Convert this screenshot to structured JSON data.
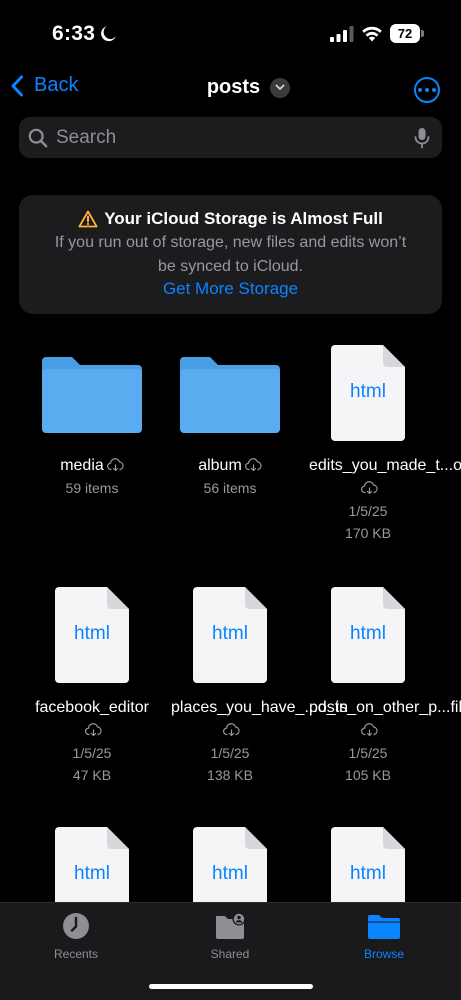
{
  "status": {
    "time": "6:33",
    "battery": "72"
  },
  "nav": {
    "back_label": "Back",
    "title": "posts"
  },
  "search": {
    "placeholder": "Search"
  },
  "banner": {
    "title": "Your iCloud Storage is Almost Full",
    "message": "If you run out of storage, new files and edits won’t be synced to iCloud.",
    "link": "Get More Storage"
  },
  "items": [
    {
      "kind": "folder",
      "name": "media",
      "meta1": "59 items",
      "meta2": ""
    },
    {
      "kind": "folder",
      "name": "album",
      "meta1": "56 items",
      "meta2": ""
    },
    {
      "kind": "file",
      "name": "edits_you_made_t...osts",
      "meta1": "1/5/25",
      "meta2": "170 KB"
    },
    {
      "kind": "file",
      "name": "facebook_editor",
      "meta1": "1/5/25",
      "meta2": "47 KB"
    },
    {
      "kind": "file",
      "name": "places_you_have_...d_in",
      "meta1": "1/5/25",
      "meta2": "138 KB"
    },
    {
      "kind": "file",
      "name": "posts_on_other_p...files",
      "meta1": "1/5/25",
      "meta2": "105 KB"
    },
    {
      "kind": "file",
      "name": "",
      "meta1": "",
      "meta2": ""
    },
    {
      "kind": "file",
      "name": "",
      "meta1": "",
      "meta2": ""
    },
    {
      "kind": "file",
      "name": "",
      "meta1": "",
      "meta2": ""
    }
  ],
  "file_type_label": "html",
  "tabs": [
    {
      "label": "Recents",
      "icon": "clock-icon"
    },
    {
      "label": "Shared",
      "icon": "shared-folder-icon"
    },
    {
      "label": "Browse",
      "icon": "folder-icon"
    }
  ],
  "colors": {
    "accent": "#0a84ff",
    "folder": "#5aacf0",
    "warning": "#ffb340"
  }
}
